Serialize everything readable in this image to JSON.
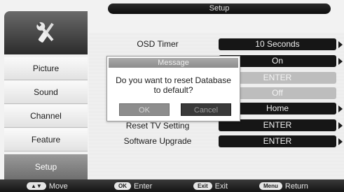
{
  "header": {
    "title": "Setup"
  },
  "sidebar": {
    "icon": "tools-icon",
    "items": [
      {
        "label": "Picture"
      },
      {
        "label": "Sound"
      },
      {
        "label": "Channel"
      },
      {
        "label": "Feature"
      },
      {
        "label": "Setup",
        "active": true
      }
    ]
  },
  "settings": {
    "osd_timer": {
      "label": "OSD Timer",
      "value": "10 Seconds"
    },
    "row2_value": "On",
    "row3_value": "ENTER",
    "row4_value": "Off",
    "row5_value": "Home",
    "reset_tv": {
      "label": "Reset TV Setting",
      "value": "ENTER"
    },
    "software_upgrade": {
      "label": "Software Upgrade",
      "value": "ENTER"
    }
  },
  "dialog": {
    "title": "Message",
    "message_line1": "Do you want to reset Database",
    "message_line2": "to default?",
    "ok_label": "OK",
    "cancel_label": "Cancel"
  },
  "footer": {
    "hints": [
      {
        "key": "▲▼",
        "label": "Move"
      },
      {
        "key": "OK",
        "label": "Enter"
      },
      {
        "key": "Exit",
        "label": "Exit"
      },
      {
        "key": "Menu",
        "label": "Return"
      }
    ]
  },
  "colors": {
    "header_bg": "#111111",
    "value_pill": "#161616",
    "active_tab": "#7f7f7f",
    "dialog_title": "#9a9a9a"
  }
}
